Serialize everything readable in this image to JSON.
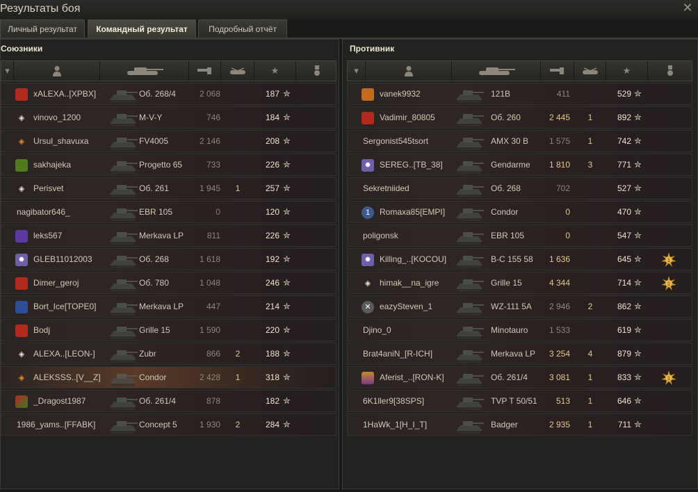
{
  "window": {
    "title": "Результаты боя",
    "close_glyph": "✕"
  },
  "tabs": [
    {
      "label": "Личный результат"
    },
    {
      "label": "Командный результат"
    },
    {
      "label": "Подробный отчёт"
    }
  ],
  "allies": {
    "title": "Союзники",
    "rows": [
      {
        "player": "xALEXA..[XPBX]",
        "vehicle": "Об. 268/4",
        "damage": "2 068",
        "kills": "",
        "xp": "187",
        "badge": "red"
      },
      {
        "player": "vinovo_1200",
        "vehicle": "M-V-Y",
        "damage": "746",
        "kills": "",
        "xp": "184",
        "badge": "diamond"
      },
      {
        "player": "Ursul_shavuxa",
        "vehicle": "FV4005",
        "damage": "2 146",
        "kills": "",
        "xp": "208",
        "badge": "diamond-orange"
      },
      {
        "player": "sakhajeka",
        "vehicle": "Progetto 65",
        "damage": "733",
        "kills": "",
        "xp": "226",
        "badge": "green"
      },
      {
        "player": "Perisvet",
        "vehicle": "Об. 261",
        "damage": "1 945",
        "kills": "1",
        "xp": "257",
        "badge": "diamond"
      },
      {
        "player": "nagibator646_",
        "vehicle": "EBR 105",
        "damage": "0",
        "kills": "",
        "xp": "120",
        "badge": ""
      },
      {
        "player": "leks567",
        "vehicle": "Merkava LP",
        "damage": "811",
        "kills": "",
        "xp": "226",
        "badge": "purple"
      },
      {
        "player": "GLEB11012003",
        "vehicle": "Об. 268",
        "damage": "1 618",
        "kills": "",
        "xp": "192",
        "badge": "star"
      },
      {
        "player": "Dimer_geroj",
        "vehicle": "Об. 780",
        "damage": "1 048",
        "kills": "",
        "xp": "246",
        "badge": "red"
      },
      {
        "player": "Bort_Ice[TOPE0]",
        "vehicle": "Merkava LP",
        "damage": "447",
        "kills": "",
        "xp": "214",
        "badge": "blue"
      },
      {
        "player": "Bodj",
        "vehicle": "Grille 15",
        "damage": "1 590",
        "kills": "",
        "xp": "220",
        "badge": "red"
      },
      {
        "player": "ALEXA..[LEON-]",
        "vehicle": "Zubr",
        "damage": "866",
        "kills": "2",
        "xp": "188",
        "badge": "diamond"
      },
      {
        "player": "ALEKSSS..[V__Z]",
        "vehicle": "Condor",
        "damage": "2 428",
        "kills": "1",
        "xp": "318",
        "badge": "diamond-orange",
        "highlight": true
      },
      {
        "player": "_Dragost1987",
        "vehicle": "Об. 261/4",
        "damage": "878",
        "kills": "",
        "xp": "182",
        "badge": "red-green"
      },
      {
        "player": "1986_yams..[FFABK]",
        "vehicle": "Concept 5",
        "damage": "1 930",
        "kills": "2",
        "xp": "284",
        "badge": ""
      }
    ]
  },
  "enemies": {
    "title": "Противник",
    "rows": [
      {
        "player": "vanek9932",
        "vehicle": "121B",
        "damage": "411",
        "kills": "",
        "xp": "529",
        "badge": "orange",
        "medal": false
      },
      {
        "player": "Vadimir_80805",
        "vehicle": "Об. 260",
        "damage": "2 445",
        "kills": "1",
        "xp": "892",
        "badge": "red",
        "medal": false
      },
      {
        "player": "Sergonist545tsort",
        "vehicle": "AMX 30 B",
        "damage": "1 575",
        "kills": "1",
        "xp": "742",
        "badge": "",
        "medal": false
      },
      {
        "player": "SEREG..[TB_38]",
        "vehicle": "Gendarme",
        "damage": "1 810",
        "kills": "3",
        "xp": "771",
        "badge": "star",
        "medal": false
      },
      {
        "player": "Sekretniided",
        "vehicle": "Об. 268",
        "damage": "702",
        "kills": "",
        "xp": "527",
        "badge": "",
        "medal": false
      },
      {
        "player": "Romaxa85[EMPI]",
        "vehicle": "Condor",
        "damage": "0",
        "kills": "",
        "xp": "470",
        "badge": "circle-1",
        "medal": false
      },
      {
        "player": "poligonsk",
        "vehicle": "EBR 105",
        "damage": "0",
        "kills": "",
        "xp": "547",
        "badge": "",
        "medal": false
      },
      {
        "player": "Killing_..[KOCOU]",
        "vehicle": "B-C 155 58",
        "damage": "1 636",
        "kills": "",
        "xp": "645",
        "badge": "star",
        "medal": true
      },
      {
        "player": "himak__na_igre",
        "vehicle": "Grille 15",
        "damage": "4 344",
        "kills": "",
        "xp": "714",
        "badge": "diamond",
        "medal": true
      },
      {
        "player": "eazySteven_1",
        "vehicle": "WZ-111 5A",
        "damage": "2 946",
        "kills": "2",
        "xp": "862",
        "badge": "circle-x",
        "medal": false
      },
      {
        "player": "Djino_0",
        "vehicle": "Minotauro",
        "damage": "1 533",
        "kills": "",
        "xp": "619",
        "badge": "",
        "medal": false
      },
      {
        "player": "Brat4aniN_[R-ICH]",
        "vehicle": "Merkava LP",
        "damage": "3 254",
        "kills": "4",
        "xp": "879",
        "badge": "",
        "medal": false
      },
      {
        "player": "Aferist_..[RON-K]",
        "vehicle": "Об. 261/4",
        "damage": "3 081",
        "kills": "1",
        "xp": "833",
        "badge": "lebwa",
        "medal": true
      },
      {
        "player": "6K1ller9[38SPS]",
        "vehicle": "TVP T 50/51",
        "damage": "513",
        "kills": "1",
        "xp": "646",
        "badge": "",
        "medal": false
      },
      {
        "player": "1HaWk_1[H_I_T]",
        "vehicle": "Badger",
        "damage": "2 935",
        "kills": "1",
        "xp": "711",
        "badge": "",
        "medal": false
      }
    ]
  },
  "icons": {
    "player_col": "person-icon",
    "tank_col": "tank-icon",
    "damage_col": "gun-icon",
    "kills_col": "destroyed-tank-icon",
    "xp_col": "star-icon",
    "medal_col": "medal-icon"
  },
  "colors": {
    "gold": "#e3c98a",
    "dim": "#8c877a",
    "zero": "#7f7a6e",
    "highlight": "#5a3a28"
  }
}
